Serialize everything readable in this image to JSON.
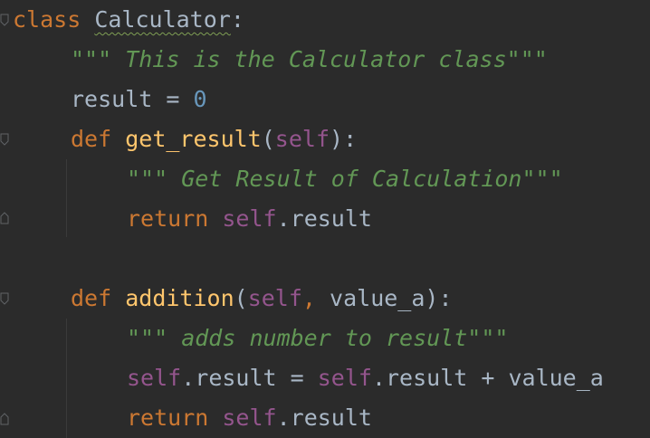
{
  "code": {
    "l1": {
      "kw": "class",
      "name": "Calculator",
      "colon": ":"
    },
    "l2": {
      "doc": "\"\"\" This is the Calculator class\"\"\""
    },
    "l3": {
      "name": "result",
      "op": " = ",
      "num": "0"
    },
    "l4": {
      "kw": "def",
      "fn": "get_result",
      "open": "(",
      "self": "self",
      "close": "):"
    },
    "l5": {
      "doc": "\"\"\" Get Result of Calculation\"\"\""
    },
    "l6": {
      "kw": "return",
      "self": "self",
      "rest": ".result"
    },
    "l8": {
      "kw": "def",
      "fn": "addition",
      "open": "(",
      "self": "self",
      "comma": ",",
      "arg": " value_a",
      "close": "):"
    },
    "l9": {
      "doc": "\"\"\" adds number to result\"\"\""
    },
    "l10": {
      "self1": "self",
      "mid": ".result = ",
      "self2": "self",
      "rest": ".result + value_a"
    },
    "l11": {
      "kw": "return",
      "self": "self",
      "rest": ".result"
    }
  },
  "colors": {
    "background": "#2b2b2b",
    "keyword": "#cc7832",
    "function": "#ffc66d",
    "self": "#94558d",
    "number": "#6897bb",
    "docstring": "#629755",
    "text": "#a9b7c6"
  },
  "icons": [
    "fold-marker-icon"
  ]
}
